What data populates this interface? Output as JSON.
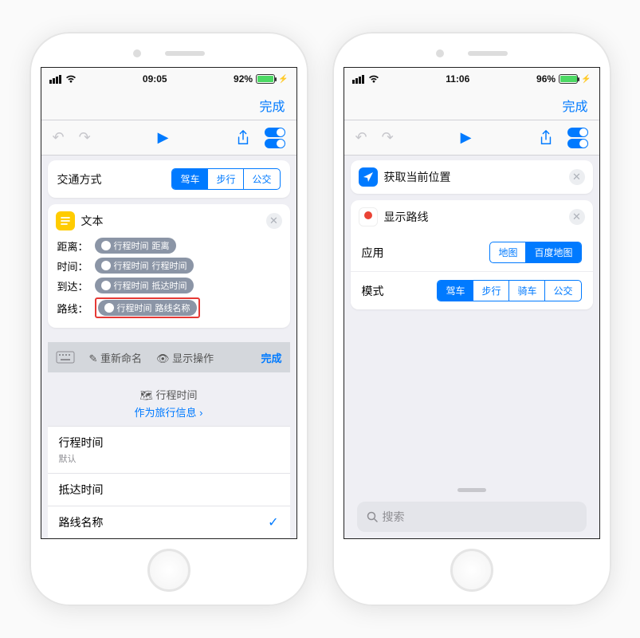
{
  "left": {
    "status": {
      "time": "09:05",
      "battery": "92%",
      "batfill": "92%"
    },
    "nav": {
      "done": "完成"
    },
    "transport": {
      "label": "交通方式",
      "segments": [
        "驾车",
        "步行",
        "公交"
      ],
      "active": 0
    },
    "textcard": {
      "title": "文本",
      "rows": [
        {
          "label": "距离：",
          "token": "行程时间",
          "suffix": "距离"
        },
        {
          "label": "时间：",
          "token": "行程时间",
          "suffix": "行程时间"
        },
        {
          "label": "到达：",
          "token": "行程时间",
          "suffix": "抵达时间"
        },
        {
          "label": "路线：",
          "token": "行程时间",
          "suffix": "路线名称",
          "highlight": true
        }
      ]
    },
    "kbbar": {
      "rename": "重新命名",
      "show": "显示操作",
      "done": "完成"
    },
    "kbheader": {
      "title": "行程时间",
      "link": "作为旅行信息"
    },
    "options": [
      {
        "label": "行程时间",
        "sub": "默认"
      },
      {
        "label": "抵达时间"
      },
      {
        "label": "路线名称",
        "checked": true
      }
    ]
  },
  "right": {
    "status": {
      "time": "11:06",
      "battery": "96%",
      "batfill": "96%"
    },
    "nav": {
      "done": "完成"
    },
    "cards": [
      {
        "icon": "location",
        "title": "获取当前位置"
      },
      {
        "icon": "pin",
        "title": "显示路线"
      }
    ],
    "app": {
      "label": "应用",
      "segments": [
        "地图",
        "百度地图"
      ],
      "active": 1
    },
    "mode": {
      "label": "模式",
      "segments": [
        "驾车",
        "步行",
        "骑车",
        "公交"
      ],
      "active": 0
    },
    "search": "搜索"
  }
}
